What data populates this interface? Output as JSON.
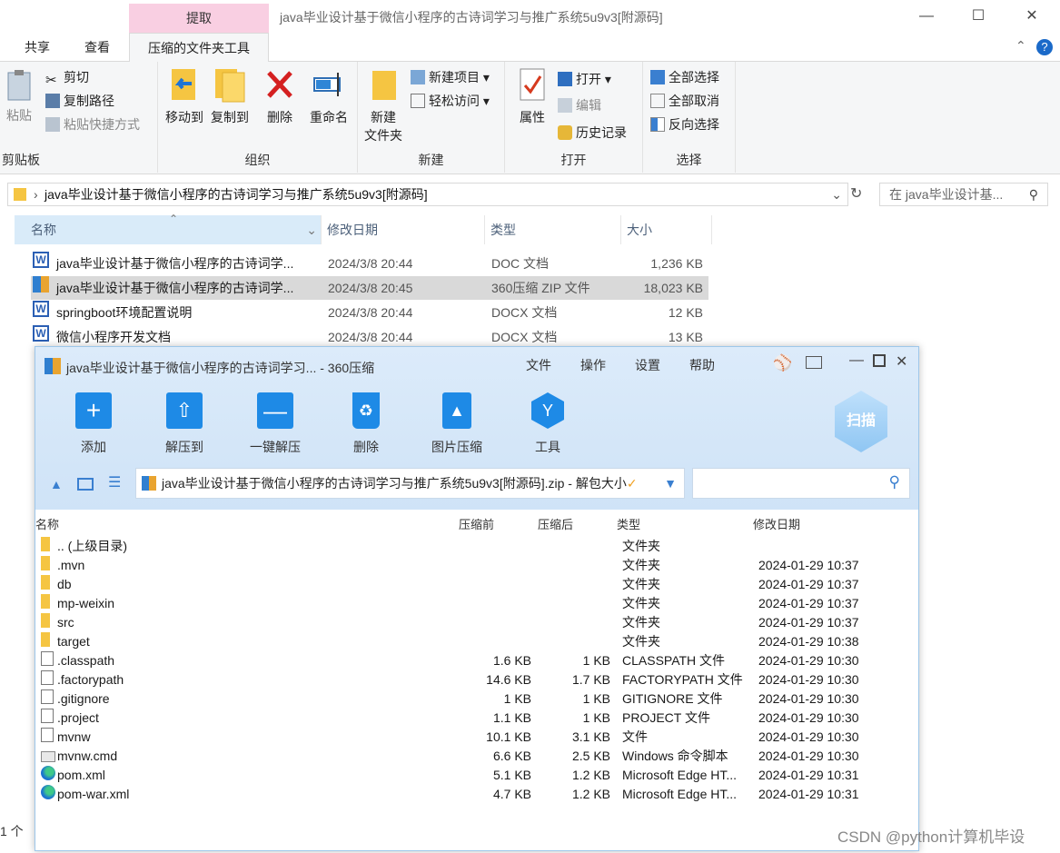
{
  "window": {
    "context_tab": "提取",
    "title": "java毕业设计基于微信小程序的古诗词学习与推广系统5u9v3[附源码]"
  },
  "tabs": [
    "共享",
    "查看",
    "压缩的文件夹工具"
  ],
  "ribbon": {
    "clipboard": {
      "label": "剪贴板",
      "paste": "粘贴",
      "cut": "剪切",
      "copy_path": "复制路径",
      "paste_shortcut": "粘贴快捷方式"
    },
    "organize": {
      "label": "组织",
      "move_to": "移动到",
      "copy_to": "复制到",
      "delete": "删除",
      "rename": "重命名"
    },
    "new": {
      "label": "新建",
      "new_folder_1": "新建",
      "new_folder_2": "文件夹",
      "new_item": "新建项目",
      "easy_access": "轻松访问"
    },
    "open": {
      "label": "打开",
      "properties": "属性",
      "open": "打开",
      "edit": "编辑",
      "history": "历史记录"
    },
    "select": {
      "label": "选择",
      "select_all": "全部选择",
      "select_none": "全部取消",
      "invert": "反向选择"
    }
  },
  "address": {
    "path": "java毕业设计基于微信小程序的古诗词学习与推广系统5u9v3[附源码]",
    "search_placeholder": "在 java毕业设计基..."
  },
  "columns": [
    "名称",
    "修改日期",
    "类型",
    "大小"
  ],
  "files": [
    {
      "name": "java毕业设计基于微信小程序的古诗词学...",
      "date": "2024/3/8 20:44",
      "type": "DOC 文档",
      "size": "1,236 KB",
      "icon": "word-icon"
    },
    {
      "name": "java毕业设计基于微信小程序的古诗词学...",
      "date": "2024/3/8 20:45",
      "type": "360压缩 ZIP 文件",
      "size": "18,023 KB",
      "icon": "zip-icon"
    },
    {
      "name": "springboot环境配置说明",
      "date": "2024/3/8 20:44",
      "type": "DOCX 文档",
      "size": "12 KB",
      "icon": "word-icon"
    },
    {
      "name": "微信小程序开发文档",
      "date": "2024/3/8 20:44",
      "type": "DOCX 文档",
      "size": "13 KB",
      "icon": "word-icon"
    }
  ],
  "status": "1 个",
  "zip": {
    "title": "java毕业设计基于微信小程序的古诗词学习... - 360压缩",
    "menu": [
      "文件",
      "操作",
      "设置",
      "帮助"
    ],
    "tools": [
      "添加",
      "解压到",
      "一键解压",
      "删除",
      "图片压缩",
      "工具"
    ],
    "scan": "扫描",
    "path": "java毕业设计基于微信小程序的古诗词学习与推广系统5u9v3[附源码].zip - 解包大小",
    "columns": [
      "名称",
      "压缩前",
      "压缩后",
      "类型",
      "修改日期"
    ],
    "rows": [
      {
        "name": ".. (上级目录)",
        "before": "",
        "after": "",
        "type": "文件夹",
        "date": "",
        "icon": "folder"
      },
      {
        "name": ".mvn",
        "before": "",
        "after": "",
        "type": "文件夹",
        "date": "2024-01-29 10:37",
        "icon": "folder"
      },
      {
        "name": "db",
        "before": "",
        "after": "",
        "type": "文件夹",
        "date": "2024-01-29 10:37",
        "icon": "folder"
      },
      {
        "name": "mp-weixin",
        "before": "",
        "after": "",
        "type": "文件夹",
        "date": "2024-01-29 10:37",
        "icon": "folder"
      },
      {
        "name": "src",
        "before": "",
        "after": "",
        "type": "文件夹",
        "date": "2024-01-29 10:37",
        "icon": "folder"
      },
      {
        "name": "target",
        "before": "",
        "after": "",
        "type": "文件夹",
        "date": "2024-01-29 10:38",
        "icon": "folder"
      },
      {
        "name": ".classpath",
        "before": "1.6 KB",
        "after": "1 KB",
        "type": "CLASSPATH 文件",
        "date": "2024-01-29 10:30",
        "icon": "file"
      },
      {
        "name": ".factorypath",
        "before": "14.6 KB",
        "after": "1.7 KB",
        "type": "FACTORYPATH 文件",
        "date": "2024-01-29 10:30",
        "icon": "file"
      },
      {
        "name": ".gitignore",
        "before": "1 KB",
        "after": "1 KB",
        "type": "GITIGNORE 文件",
        "date": "2024-01-29 10:30",
        "icon": "file"
      },
      {
        "name": ".project",
        "before": "1.1 KB",
        "after": "1 KB",
        "type": "PROJECT 文件",
        "date": "2024-01-29 10:30",
        "icon": "file"
      },
      {
        "name": "mvnw",
        "before": "10.1 KB",
        "after": "3.1 KB",
        "type": "文件",
        "date": "2024-01-29 10:30",
        "icon": "file"
      },
      {
        "name": "mvnw.cmd",
        "before": "6.6 KB",
        "after": "2.5 KB",
        "type": "Windows 命令脚本",
        "date": "2024-01-29 10:30",
        "icon": "cmd"
      },
      {
        "name": "pom.xml",
        "before": "5.1 KB",
        "after": "1.2 KB",
        "type": "Microsoft Edge HT...",
        "date": "2024-01-29 10:31",
        "icon": "edge"
      },
      {
        "name": "pom-war.xml",
        "before": "4.7 KB",
        "after": "1.2 KB",
        "type": "Microsoft Edge HT...",
        "date": "2024-01-29 10:31",
        "icon": "edge"
      }
    ]
  },
  "watermark": "CSDN @python计算机毕设"
}
